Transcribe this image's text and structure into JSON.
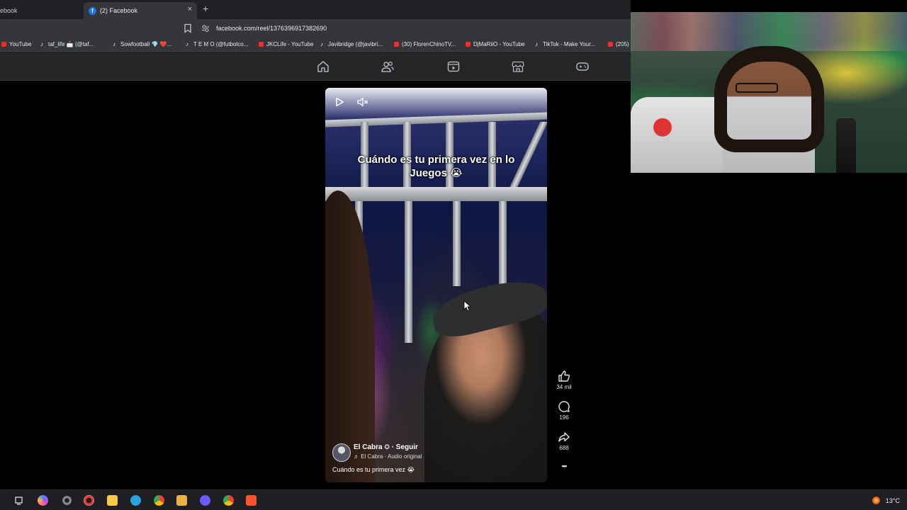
{
  "browser": {
    "prev_tab_label": "ebook",
    "active_tab": {
      "favicon": "f",
      "title": "(2) Facebook"
    },
    "new_tab": "+",
    "close": "×",
    "url": "facebook.com/reel/1376396917382690"
  },
  "bookmarks": [
    {
      "icon": "youtube-icon",
      "label": "YouTube"
    },
    {
      "icon": "tiktok-icon",
      "label": "taf_life 📩 (@taf..."
    },
    {
      "icon": "tiktok-icon",
      "label": "Sowfootball 💎 ❤️..."
    },
    {
      "icon": "tiktok-icon",
      "label": "T E M O (@futbolco..."
    },
    {
      "icon": "youtube-icon",
      "label": "JKCLife - YouTube"
    },
    {
      "icon": "tiktok-icon",
      "label": "Javibridge (@javibri..."
    },
    {
      "icon": "youtube-icon",
      "label": "(30) FlorenChinoTV..."
    },
    {
      "icon": "youtube-icon",
      "label": "DjMaRiiO - YouTube"
    },
    {
      "icon": "tiktok-icon",
      "label": "TikTok - Make Your..."
    },
    {
      "icon": "youtube-icon",
      "label": "(205)"
    }
  ],
  "fb_nav": [
    "home-icon",
    "friends-icon",
    "video-icon",
    "marketplace-icon",
    "gaming-icon"
  ],
  "reel": {
    "caption_line1": "Cuándo es tu primera vez en lo",
    "caption_line2": "Juegos 😭",
    "author": "El Cabra",
    "follow": "· Seguir",
    "audio": "♬ El Cabra · Audio original",
    "description": "Cuándo es tu primera vez 😭"
  },
  "actions": {
    "likes": "34 mil",
    "comments": "196",
    "shares": "688",
    "more": "•••"
  },
  "taskbar": {
    "temperature": "13°C"
  },
  "colors": {
    "chrome_dark": "#202124",
    "chrome_bar": "#35363a",
    "facebook_blue": "#1877f2",
    "youtube_red": "#ff2a2a"
  }
}
